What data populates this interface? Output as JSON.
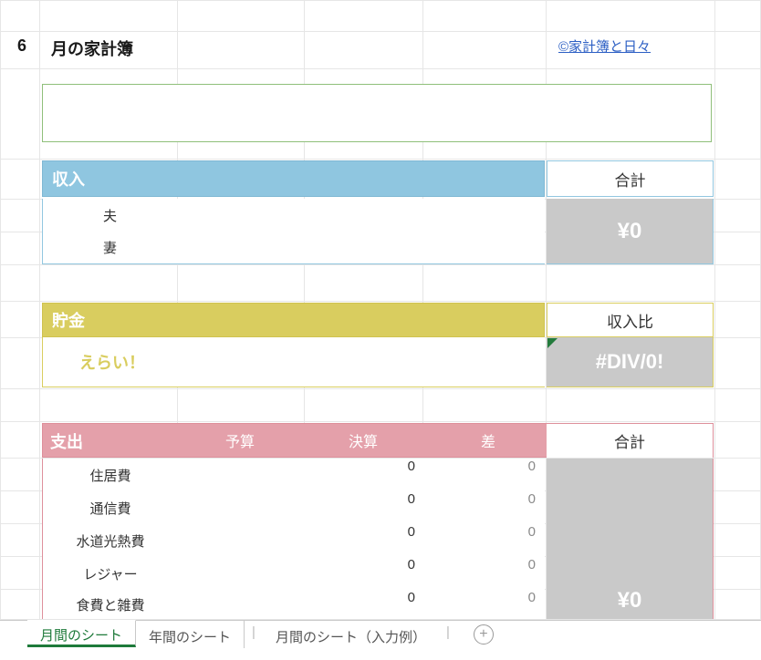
{
  "header": {
    "month": "6",
    "title": "月の家計簿",
    "link": "©家計簿と日々"
  },
  "income": {
    "heading": "収入",
    "total_label": "合計",
    "rows": [
      "夫",
      "妻"
    ],
    "total_value": "¥0"
  },
  "savings": {
    "heading": "貯金",
    "ratio_label": "収入比",
    "praise": "えらい！",
    "ratio_value": "#DIV/0!"
  },
  "expenses": {
    "heading": "支出",
    "cols": {
      "budget": "予算",
      "actual": "決算",
      "diff": "差"
    },
    "total_label": "合計",
    "rows": [
      {
        "cat": "住居費",
        "actual": "0",
        "diff": "0"
      },
      {
        "cat": "通信費",
        "actual": "0",
        "diff": "0"
      },
      {
        "cat": "水道光熱費",
        "actual": "0",
        "diff": "0"
      },
      {
        "cat": "レジャー",
        "actual": "0",
        "diff": "0"
      },
      {
        "cat": "食費と雑費",
        "actual": "0",
        "diff": "0"
      }
    ],
    "total_value": "¥0"
  },
  "tabs": {
    "items": [
      "月間のシート",
      "年間のシート",
      "月間のシート（入力例）"
    ],
    "active": 0
  }
}
